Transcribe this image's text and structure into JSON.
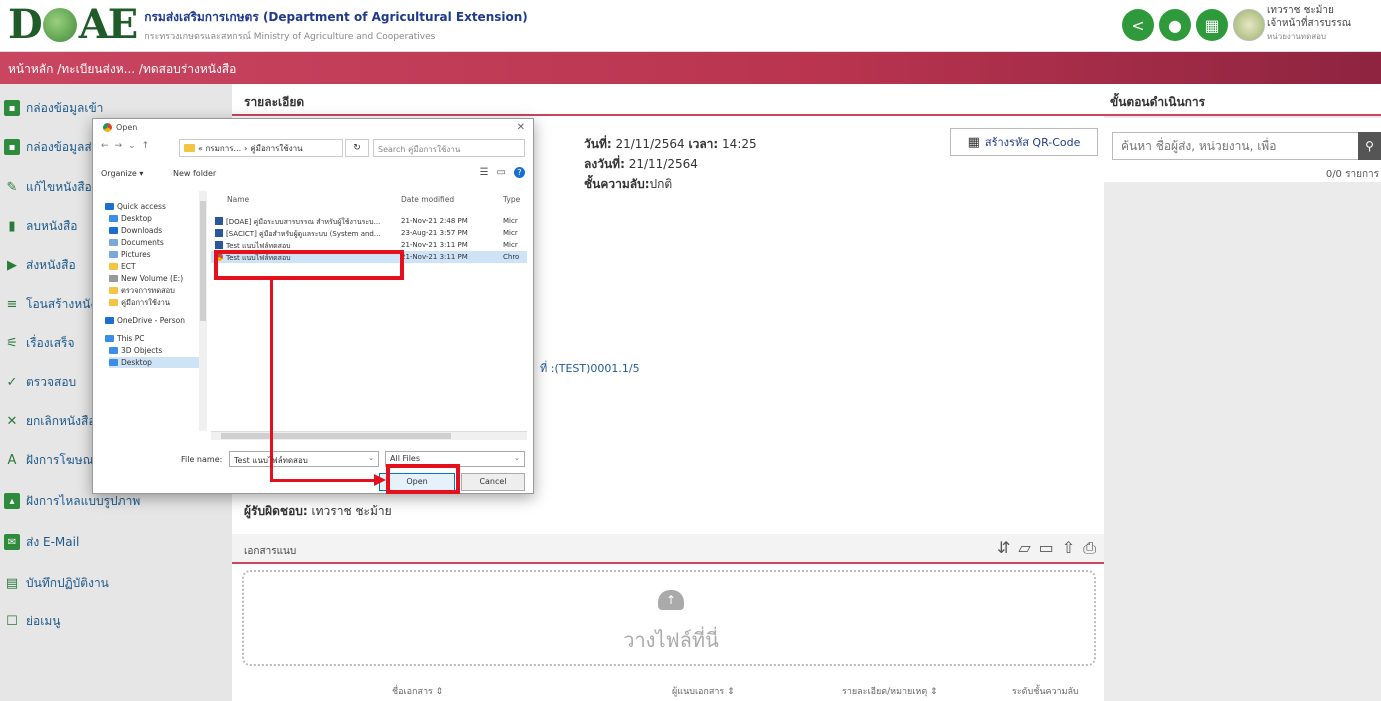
{
  "header": {
    "logo_text": "D",
    "logo_text2": "AE",
    "org_title": "กรมส่งเสริมการเกษตร (Department of Agricultural Extension)",
    "org_sub": "กระทรวงเกษตรและสหกรณ์ Ministry of Agriculture and Cooperatives",
    "user_name": "เทวราช ชะม้าย",
    "user_role": "เจ้าหน้าที่สารบรรณ",
    "user_unit": "หน่วยงานทดสอบ",
    "icons": [
      "share-icon",
      "bell-icon",
      "grid-icon"
    ]
  },
  "breadcrumb": "หน้าหลัก /ทะเบียนส่งห... /ทดสอบร่างหนังสือ",
  "sidebar": {
    "items": [
      {
        "label": "กล่องข้อมูลเข้า",
        "icon": "inbox-icon"
      },
      {
        "label": "กล่องข้อมูลส่ง",
        "icon": "outbox-icon"
      },
      {
        "label": "แก้ไขหนังสือ",
        "icon": "pencil-icon"
      },
      {
        "label": "ลบหนังสือ",
        "icon": "trash-icon"
      },
      {
        "label": "ส่งหนังสือ",
        "icon": "send-icon"
      },
      {
        "label": "โอนสร้างหนังสือ",
        "icon": "transfer-icon"
      },
      {
        "label": "เรื่องเสร็จ",
        "icon": "done-icon"
      },
      {
        "label": "ตรวจสอบ",
        "icon": "check-icon"
      },
      {
        "label": "ยกเลิกหนังสือ",
        "icon": "cancel-icon"
      },
      {
        "label": "ฝังการโฆษณา",
        "icon": "text-icon"
      },
      {
        "label": "ฝังการไหลแบบรูปภาพ",
        "icon": "image-icon"
      },
      {
        "label": "ส่ง E-Mail",
        "icon": "mail-icon"
      },
      {
        "label": "บันทึกปฏิบัติงาน",
        "icon": "log-icon"
      },
      {
        "label": "ย่อเมนู",
        "icon": "collapse-icon"
      }
    ]
  },
  "main": {
    "section_title": "รายละเอียด",
    "date_label": "วันที่:",
    "date_value": "21/11/2564",
    "time_label": "เวลา:",
    "time_value": "14:25",
    "signed_label": "ลงวันที่:",
    "signed_value": "21/11/2564",
    "secrecy_label": "ชั้นความลับ:",
    "secrecy_value": "ปกติ",
    "qr_button": "สร้างรหัส QR-Code",
    "book_no": "ที่ :(TEST)0001.1/5",
    "responsible_label": "ผู้รับผิดชอบ:",
    "responsible_value": "เทวราช ชะม้าย",
    "attach_label": "เอกสารแนบ",
    "drop_text": "วางไฟล์ที่นี่",
    "columns": [
      "ชื่อเอกสาร ⇕",
      "ผู้แนบเอกสาร ⇕",
      "รายละเอียด/หมายเหตุ ⇕",
      "ระดับชั้นความลับ"
    ]
  },
  "right": {
    "title": "ขั้นตอนดำเนินการ",
    "search_placeholder": "ค้นหา ชื่อผู้ส่ง, หน่วยงาน, เพื่อ",
    "count": "0/0 รายการ"
  },
  "dialog": {
    "title": "Open",
    "path_part1": "« กรมการ...",
    "path_part2": "คู่มือการใช้งาน",
    "search_placeholder": "Search คู่มือการใช้งาน",
    "organize": "Organize ▾",
    "new_folder": "New folder",
    "nav_items": [
      {
        "label": "Quick access",
        "color": "#1a6fcf"
      },
      {
        "label": "Desktop",
        "color": "#3a8ee6"
      },
      {
        "label": "Downloads",
        "color": "#1a6fcf"
      },
      {
        "label": "Documents",
        "color": "#7aa8d8"
      },
      {
        "label": "Pictures",
        "color": "#7aa8d8"
      },
      {
        "label": "ECT",
        "color": "#f4c542"
      },
      {
        "label": "New Volume (E:)",
        "color": "#999"
      },
      {
        "label": "ตรวจการทดสอบ",
        "color": "#f4c542"
      },
      {
        "label": "คู่มือการใช้งาน",
        "color": "#f4c542"
      },
      {
        "label": "OneDrive - Person",
        "color": "#1a6fcf"
      },
      {
        "label": "This PC",
        "color": "#3a8ee6"
      },
      {
        "label": "3D Objects",
        "color": "#3a8ee6"
      },
      {
        "label": "Desktop",
        "color": "#3a8ee6"
      }
    ],
    "col_name": "Name",
    "col_date": "Date modified",
    "col_type": "Type",
    "files": [
      {
        "name": "[DOAE] คู่มือระบบสารบรรณ สำหรับผู้ใช้งานระบ...",
        "date": "21-Nov-21 2:48 PM",
        "type": "Micr"
      },
      {
        "name": "[SACICT] คู่มือสำหรับผู้ดูแลระบบ (System and...",
        "date": "23-Aug-21 3:57 PM",
        "type": "Micr"
      },
      {
        "name": "Test แนบไฟล์ทดสอบ",
        "date": "21-Nov-21 3:11 PM",
        "type": "Micr"
      },
      {
        "name": "Test แนบไฟล์ทดสอบ",
        "date": "21-Nov-21 3:11 PM",
        "type": "Chro"
      }
    ],
    "file_name_label": "File name:",
    "file_name_value": "Test แนบไฟล์ทดสอบ",
    "file_type": "All Files",
    "open": "Open",
    "cancel": "Cancel"
  },
  "colors": {
    "accent": "#c94560",
    "green": "#2e9a3c",
    "annotation": "#e5101e"
  }
}
